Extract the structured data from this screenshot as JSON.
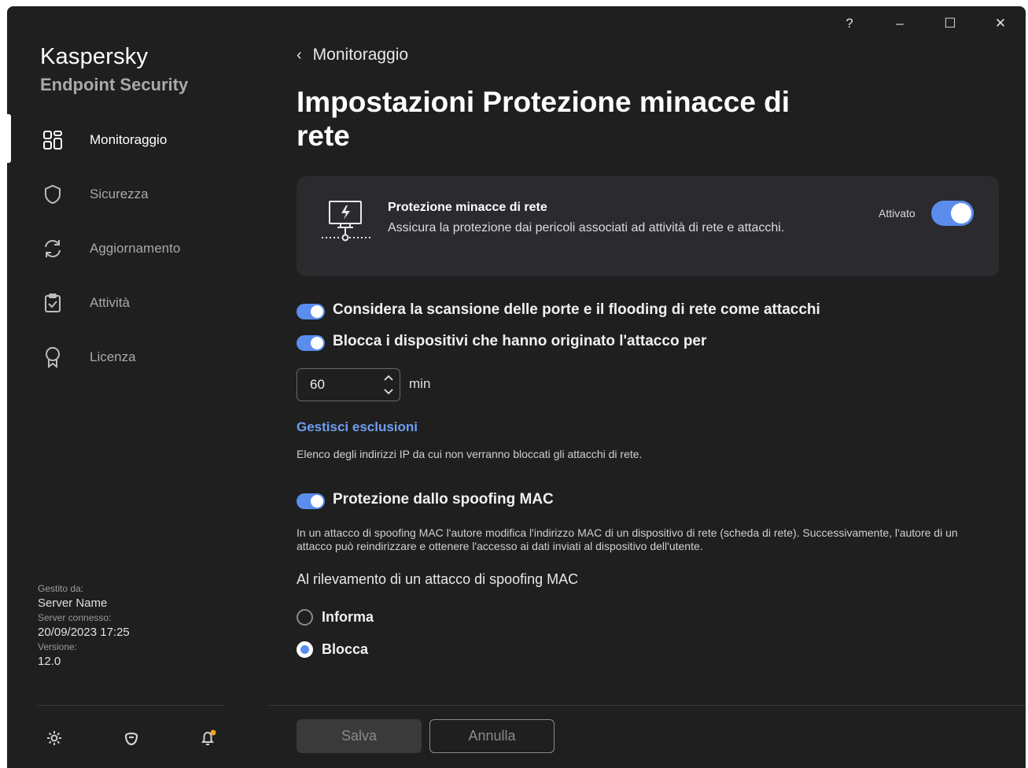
{
  "window": {
    "controls": {
      "help": "?",
      "minimize": "–",
      "maximize": "☐",
      "close": "✕"
    }
  },
  "sidebar": {
    "brand": {
      "name": "Kaspersky",
      "product": "Endpoint Security"
    },
    "items": [
      {
        "label": "Monitoraggio",
        "icon": "dashboard-icon",
        "active": true
      },
      {
        "label": "Sicurezza",
        "icon": "shield-icon",
        "active": false
      },
      {
        "label": "Aggiornamento",
        "icon": "refresh-icon",
        "active": false
      },
      {
        "label": "Attività",
        "icon": "task-clipboard-icon",
        "active": false
      },
      {
        "label": "Licenza",
        "icon": "license-ribbon-icon",
        "active": false
      }
    ],
    "managed": {
      "managed_by_label": "Gestito da:",
      "managed_by_value": "Server Name",
      "connected_label": "Server connesso:",
      "connected_value": "20/09/2023 17:25",
      "version_label": "Versione:",
      "version_value": "12.0"
    },
    "bottom_icons": [
      "settings-gear-icon",
      "support-icon",
      "notifications-bell-icon"
    ]
  },
  "main": {
    "breadcrumb": {
      "back": "‹",
      "label": "Monitoraggio"
    },
    "title": "Impostazioni Protezione minacce di rete",
    "card": {
      "icon": "network-monitor-icon",
      "title": "Protezione minacce di rete",
      "description": "Assicura la protezione dai pericoli associati ad attività di rete e attacchi.",
      "state_label": "Attivato",
      "enabled": true
    },
    "options": {
      "port_scan": {
        "label": "Considera la scansione delle porte e il flooding di rete come attacchi",
        "enabled": true
      },
      "block_devices": {
        "label": "Blocca i dispositivi che hanno originato l'attacco per",
        "enabled": true
      },
      "block_duration": {
        "value": "60",
        "unit": "min"
      },
      "exclusions": {
        "link": "Gestisci esclusioni",
        "hint": "Elenco degli indirizzi IP da cui non verranno bloccati gli attacchi di rete."
      },
      "mac_spoofing": {
        "label": "Protezione dallo spoofing MAC",
        "enabled": true,
        "description": "In un attacco di spoofing MAC l'autore modifica l'indirizzo MAC di un dispositivo di rete (scheda di rete). Successivamente, l'autore di un attacco può reindirizzare e ottenere l'accesso ai dati inviati al dispositivo dell'utente.",
        "on_detect_label": "Al rilevamento di un attacco di spoofing MAC",
        "actions": [
          {
            "label": "Informa",
            "selected": false
          },
          {
            "label": "Blocca",
            "selected": true
          }
        ]
      }
    },
    "footer": {
      "save": "Salva",
      "cancel": "Annulla"
    }
  },
  "colors": {
    "background": "#1f1f1f",
    "card": "#2b2b2f",
    "accent": "#5b8def",
    "link": "#6e9ff2"
  }
}
